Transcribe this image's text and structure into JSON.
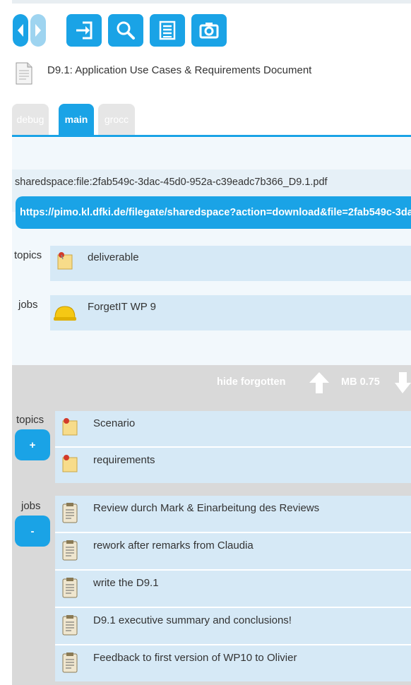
{
  "toolbar": {
    "buttons": [
      {
        "name": "back",
        "icon": "chevron-left-icon"
      },
      {
        "name": "forward",
        "icon": "chevron-right-icon"
      },
      {
        "name": "open",
        "icon": "enter-icon"
      },
      {
        "name": "search",
        "icon": "search-icon"
      },
      {
        "name": "list",
        "icon": "list-icon"
      },
      {
        "name": "camera",
        "icon": "camera-icon"
      }
    ]
  },
  "document": {
    "title": "D9.1: Application Use Cases & Requirements Document",
    "icon": "document-icon"
  },
  "tabs": [
    {
      "label": "debug",
      "active": false
    },
    {
      "label": "main",
      "active": true
    },
    {
      "label": "grocc",
      "active": false
    }
  ],
  "resource": {
    "path": "sharedspace:file:2fab549c-3dac-45d0-952a-c39eadc7b366_D9.1.pdf",
    "url": "https://pimo.kl.dfki.de/filegate/sharedspace?action=download&file=2fab549c-3dac-45d0-952a-c39eadc7b366_D9.1.pdf"
  },
  "upper": {
    "topics_label": "topics",
    "topics": [
      {
        "label": "deliverable",
        "icon": "note-pin-icon"
      }
    ],
    "jobs_label": "jobs",
    "jobs": [
      {
        "label": "ForgetIT WP 9",
        "icon": "hard-hat-icon"
      }
    ]
  },
  "forget_bar": {
    "hide_label": "hide forgotten",
    "size_label": "MB 0.75"
  },
  "lower": {
    "topics_label": "topics",
    "topics_toggle": "+",
    "topics": [
      {
        "label": "Scenario"
      },
      {
        "label": "requirements"
      }
    ],
    "jobs_label": "jobs",
    "jobs_toggle": "-",
    "jobs": [
      {
        "label": "Review durch Mark & Einarbeitung des Reviews"
      },
      {
        "label": "rework after remarks from Claudia"
      },
      {
        "label": "write the D9.1"
      },
      {
        "label": "D9.1 executive summary and conclusions!"
      },
      {
        "label": "Feedback to first version of WP10 to Olivier"
      }
    ]
  },
  "colors": {
    "accent": "#1aa3e6",
    "item_bg": "#d6e9f6",
    "panel_bg": "#f2f8fc",
    "gray_bar": "#d9d9d9"
  }
}
